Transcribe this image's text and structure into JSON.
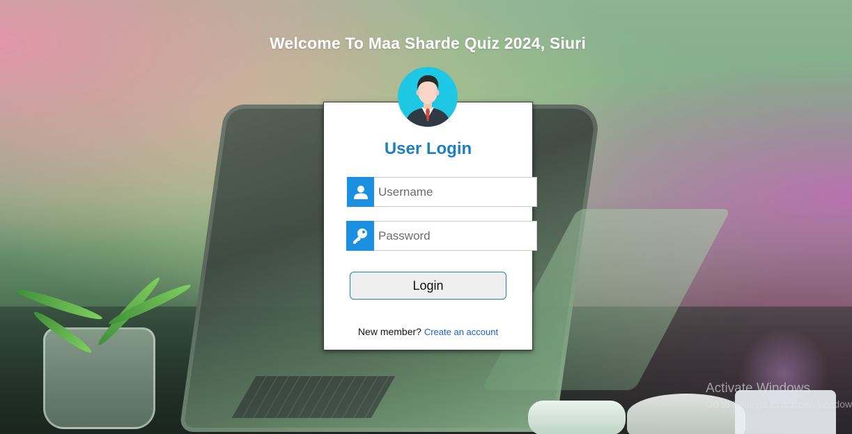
{
  "page": {
    "welcome_title": "Welcome To Maa Sharde Quiz 2024, Siuri"
  },
  "login_card": {
    "title": "User Login",
    "avatar_icon": "user-avatar-icon",
    "username": {
      "icon": "user-icon",
      "placeholder": "Username",
      "value": ""
    },
    "password": {
      "icon": "key-icon",
      "placeholder": "Password",
      "value": ""
    },
    "login_button_label": "Login",
    "signup_prompt": "New member?",
    "signup_link_label": "Create an account"
  },
  "colors": {
    "accent_blue": "#1b8fe0",
    "title_blue": "#1a7fc4",
    "link_blue": "#1a5fd0",
    "avatar_bg": "#1ec8e4"
  },
  "watermark": {
    "title": "Activate Windows",
    "subtitle": "Go to Settings to activate Windows."
  }
}
